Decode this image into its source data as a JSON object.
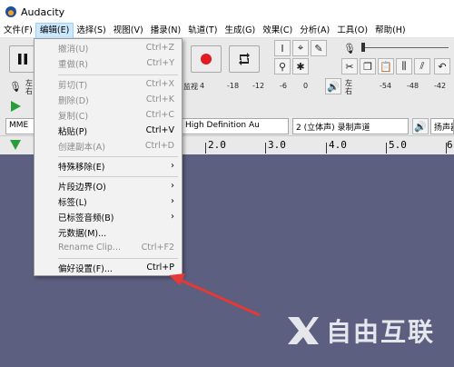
{
  "window": {
    "title": "Audacity"
  },
  "menubar": {
    "items": [
      {
        "label": "文件(F)"
      },
      {
        "label": "编辑(E)"
      },
      {
        "label": "选择(S)"
      },
      {
        "label": "视图(V)"
      },
      {
        "label": "播录(N)"
      },
      {
        "label": "轨道(T)"
      },
      {
        "label": "生成(G)"
      },
      {
        "label": "效果(C)"
      },
      {
        "label": "分析(A)"
      },
      {
        "label": "工具(O)"
      },
      {
        "label": "帮助(H)"
      }
    ]
  },
  "edit_menu": {
    "items": [
      {
        "label": "撤消(U)",
        "shortcut": "Ctrl+Z",
        "enabled": false
      },
      {
        "label": "重做(R)",
        "shortcut": "Ctrl+Y",
        "enabled": false
      },
      {
        "label": "剪切(T)",
        "shortcut": "Ctrl+X",
        "enabled": false
      },
      {
        "label": "删除(D)",
        "shortcut": "Ctrl+K",
        "enabled": false
      },
      {
        "label": "复制(C)",
        "shortcut": "Ctrl+C",
        "enabled": false
      },
      {
        "label": "粘贴(P)",
        "shortcut": "Ctrl+V",
        "enabled": true
      },
      {
        "label": "创建副本(A)",
        "shortcut": "Ctrl+D",
        "enabled": false
      },
      {
        "label": "特殊移除(E)",
        "submenu": true
      },
      {
        "label": "片段边界(O)",
        "submenu": true
      },
      {
        "label": "标签(L)",
        "submenu": true
      },
      {
        "label": "已标签音频(B)",
        "submenu": true
      },
      {
        "label": "元数据(M)...",
        "enabled": true
      },
      {
        "label": "Rename Clip...",
        "shortcut": "Ctrl+F2",
        "enabled": false
      },
      {
        "label": "偏好设置(F)...",
        "shortcut": "Ctrl+P",
        "enabled": true
      }
    ]
  },
  "toolbar": {
    "meter_left": {
      "l": "左",
      "r": "右"
    },
    "monitor_label": "监视",
    "meter_ticks_left": [
      "-18",
      "-12",
      "-6",
      "0"
    ],
    "meter_first": "4",
    "meter_ticks_right": [
      "-54",
      "-48",
      "-42"
    ],
    "audio_host": "MME",
    "device_output": "High Definition Au",
    "channels": "2 (立体声) 录制声道",
    "speaker_device": "扬声器",
    "l_short": "左",
    "r_short": "右"
  },
  "ruler": {
    "labels": [
      "2.0",
      "3.0",
      "4.0",
      "5.0",
      "6"
    ]
  },
  "watermark": {
    "text": "自由互联"
  },
  "colors": {
    "background": "#5c5f80",
    "record": "#e01b24",
    "arrow": "#e53935",
    "menu_active": "#cce8ff"
  }
}
